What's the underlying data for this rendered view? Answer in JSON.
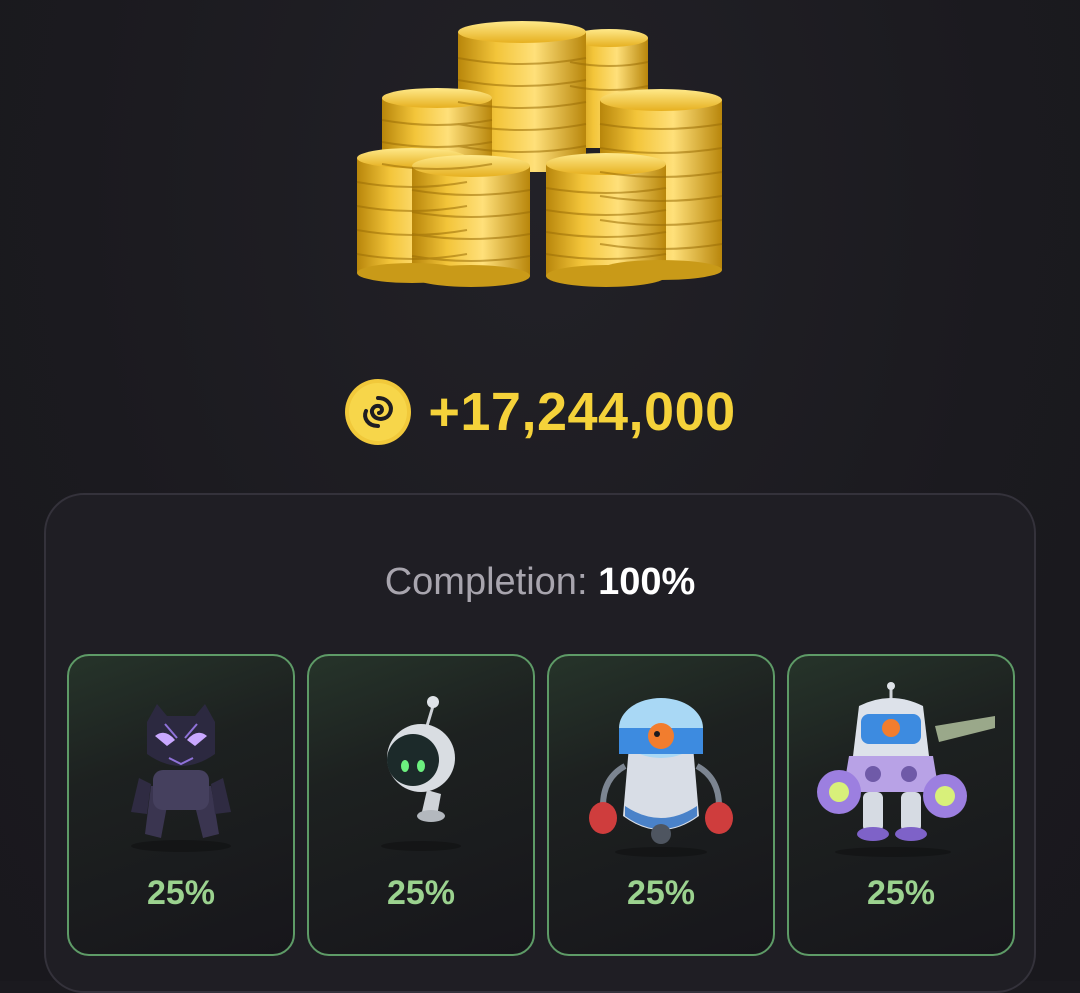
{
  "reward": {
    "icon": "swirl-token-icon",
    "amount": "+17,244,000",
    "color": "#f5d23a"
  },
  "completion": {
    "label": "Completion:",
    "value": "100%"
  },
  "items": [
    {
      "icon": "panther-character-icon",
      "percent": "25%"
    },
    {
      "icon": "astronaut-bot-character-icon",
      "percent": "25%"
    },
    {
      "icon": "boxer-robot-character-icon",
      "percent": "25%"
    },
    {
      "icon": "mech-robot-character-icon",
      "percent": "25%"
    }
  ],
  "colors": {
    "background": "#1b1a1f",
    "accent_green": "#9bd28f",
    "border_green": "#5e9b67",
    "gold": "#f5d23a"
  }
}
